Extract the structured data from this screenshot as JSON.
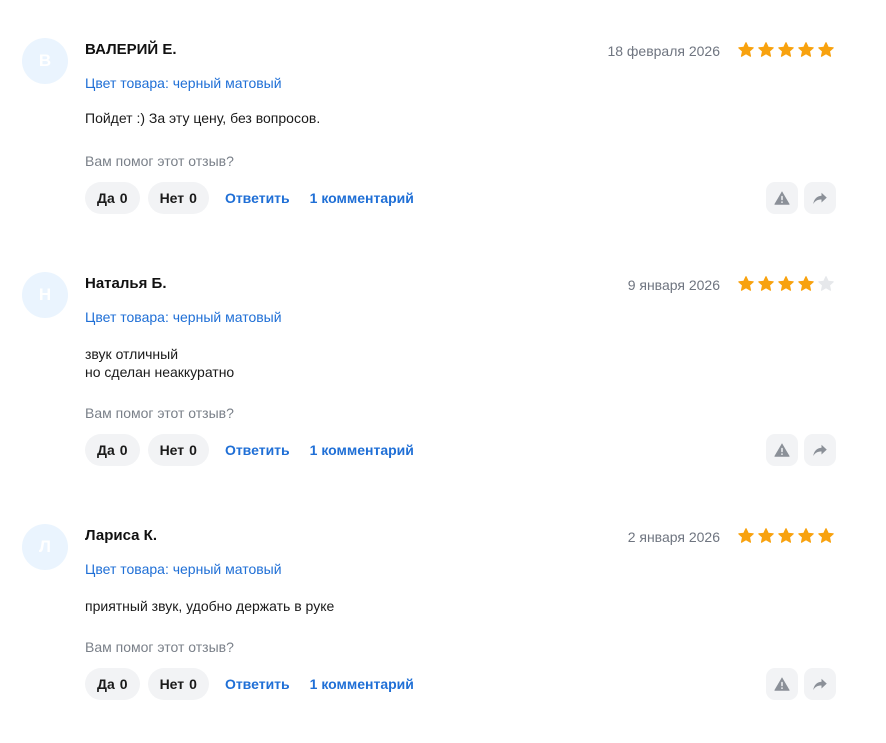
{
  "reviews": [
    {
      "avatar_letter": "В",
      "author": "ВАЛЕРИЙ Е.",
      "date": "18 февраля 2026",
      "rating": 5,
      "variant": "Цвет товара: черный матовый",
      "text": "Пойдет :) За эту цену, без вопросов.",
      "helpful_prompt": "Вам помог этот отзыв?",
      "yes_label": "Да",
      "yes_count": "0",
      "no_label": "Нет",
      "no_count": "0",
      "reply_label": "Ответить",
      "comments_label": "1 комментарий"
    },
    {
      "avatar_letter": "Н",
      "author": "Наталья Б.",
      "date": "9 января 2026",
      "rating": 4,
      "variant": "Цвет товара: черный матовый",
      "text": "звук отличный\nно сделан неаккуратно",
      "helpful_prompt": "Вам помог этот отзыв?",
      "yes_label": "Да",
      "yes_count": "0",
      "no_label": "Нет",
      "no_count": "0",
      "reply_label": "Ответить",
      "comments_label": "1 комментарий"
    },
    {
      "avatar_letter": "Л",
      "author": "Лариса К.",
      "date": "2 января 2026",
      "rating": 5,
      "variant": "Цвет товара: черный матовый",
      "text": "приятный звук, удобно держать в руке",
      "helpful_prompt": "Вам помог этот отзыв?",
      "yes_label": "Да",
      "yes_count": "0",
      "no_label": "Нет",
      "no_count": "0",
      "reply_label": "Ответить",
      "comments_label": "1 комментарий"
    }
  ],
  "colors": {
    "star_filled": "#f8a20f",
    "star_empty": "#e6e8eb",
    "link": "#1f6fd6",
    "avatar_bg": "#eaf4fe"
  },
  "icons": {
    "report": "warning-triangle-icon",
    "share": "share-arrow-icon",
    "star": "star-icon"
  }
}
